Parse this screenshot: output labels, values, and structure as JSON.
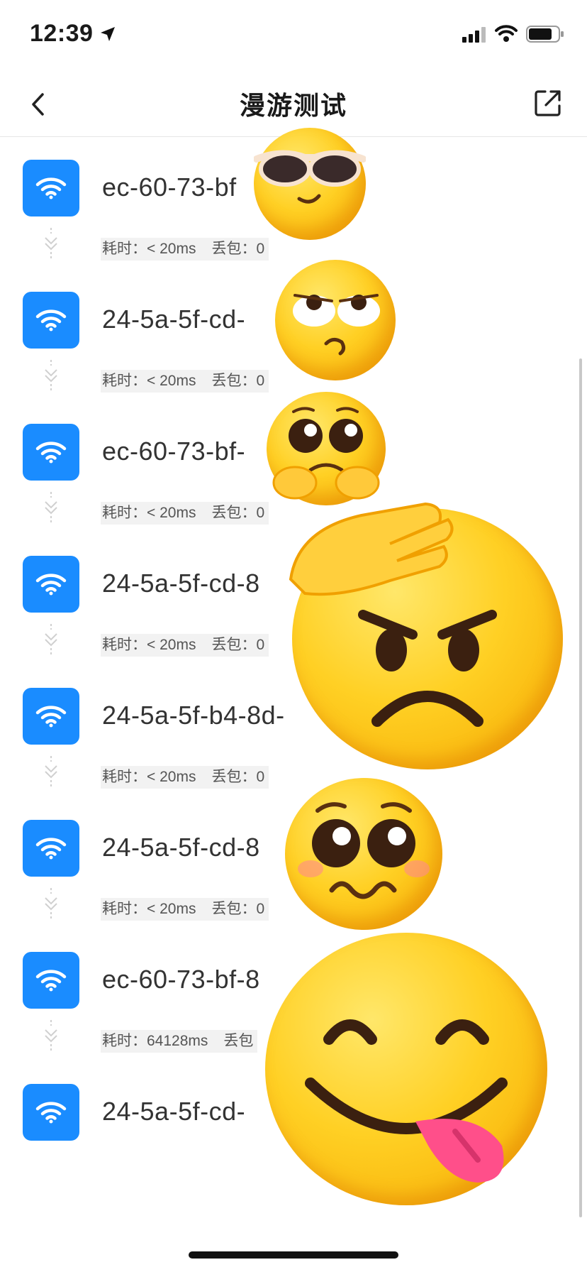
{
  "status_bar": {
    "time": "12:39"
  },
  "nav": {
    "title": "漫游测试"
  },
  "rows": [
    {
      "name": "ec-60-73-bf"
    },
    {
      "name": "24-5a-5f-cd-"
    },
    {
      "name": "ec-60-73-bf-"
    },
    {
      "name": "24-5a-5f-cd-8"
    },
    {
      "name": "24-5a-5f-b4-8d-"
    },
    {
      "name": "24-5a-5f-cd-8"
    },
    {
      "name": "ec-60-73-bf-8"
    },
    {
      "name": "24-5a-5f-cd-"
    }
  ],
  "links": [
    {
      "time_label": "耗时：< 20ms",
      "loss_label": "丢包：0"
    },
    {
      "time_label": "耗时：< 20ms",
      "loss_label": "丢包：0"
    },
    {
      "time_label": "耗时：< 20ms",
      "loss_label": "丢包：0"
    },
    {
      "time_label": "耗时：< 20ms",
      "loss_label": "丢包：0"
    },
    {
      "time_label": "耗时：< 20ms",
      "loss_label": "丢包：0"
    },
    {
      "time_label": "耗时：< 20ms",
      "loss_label": "丢包：0"
    },
    {
      "time_label": "耗时：64128ms",
      "loss_label": "丢包"
    }
  ],
  "icons": {
    "back": "chevron-left-icon",
    "share": "share-icon",
    "row": "wifi-icon",
    "link": "chevron-down-icon"
  },
  "colors": {
    "accent": "#1a8cff",
    "stat_bg": "#f2f2f2"
  },
  "stickers": [
    "sunglasses-emoji",
    "eye-roll-emoji",
    "pleading-hands-emoji",
    "angry-facepalm-emoji",
    "pleading-emoji",
    "yum-emoji"
  ]
}
